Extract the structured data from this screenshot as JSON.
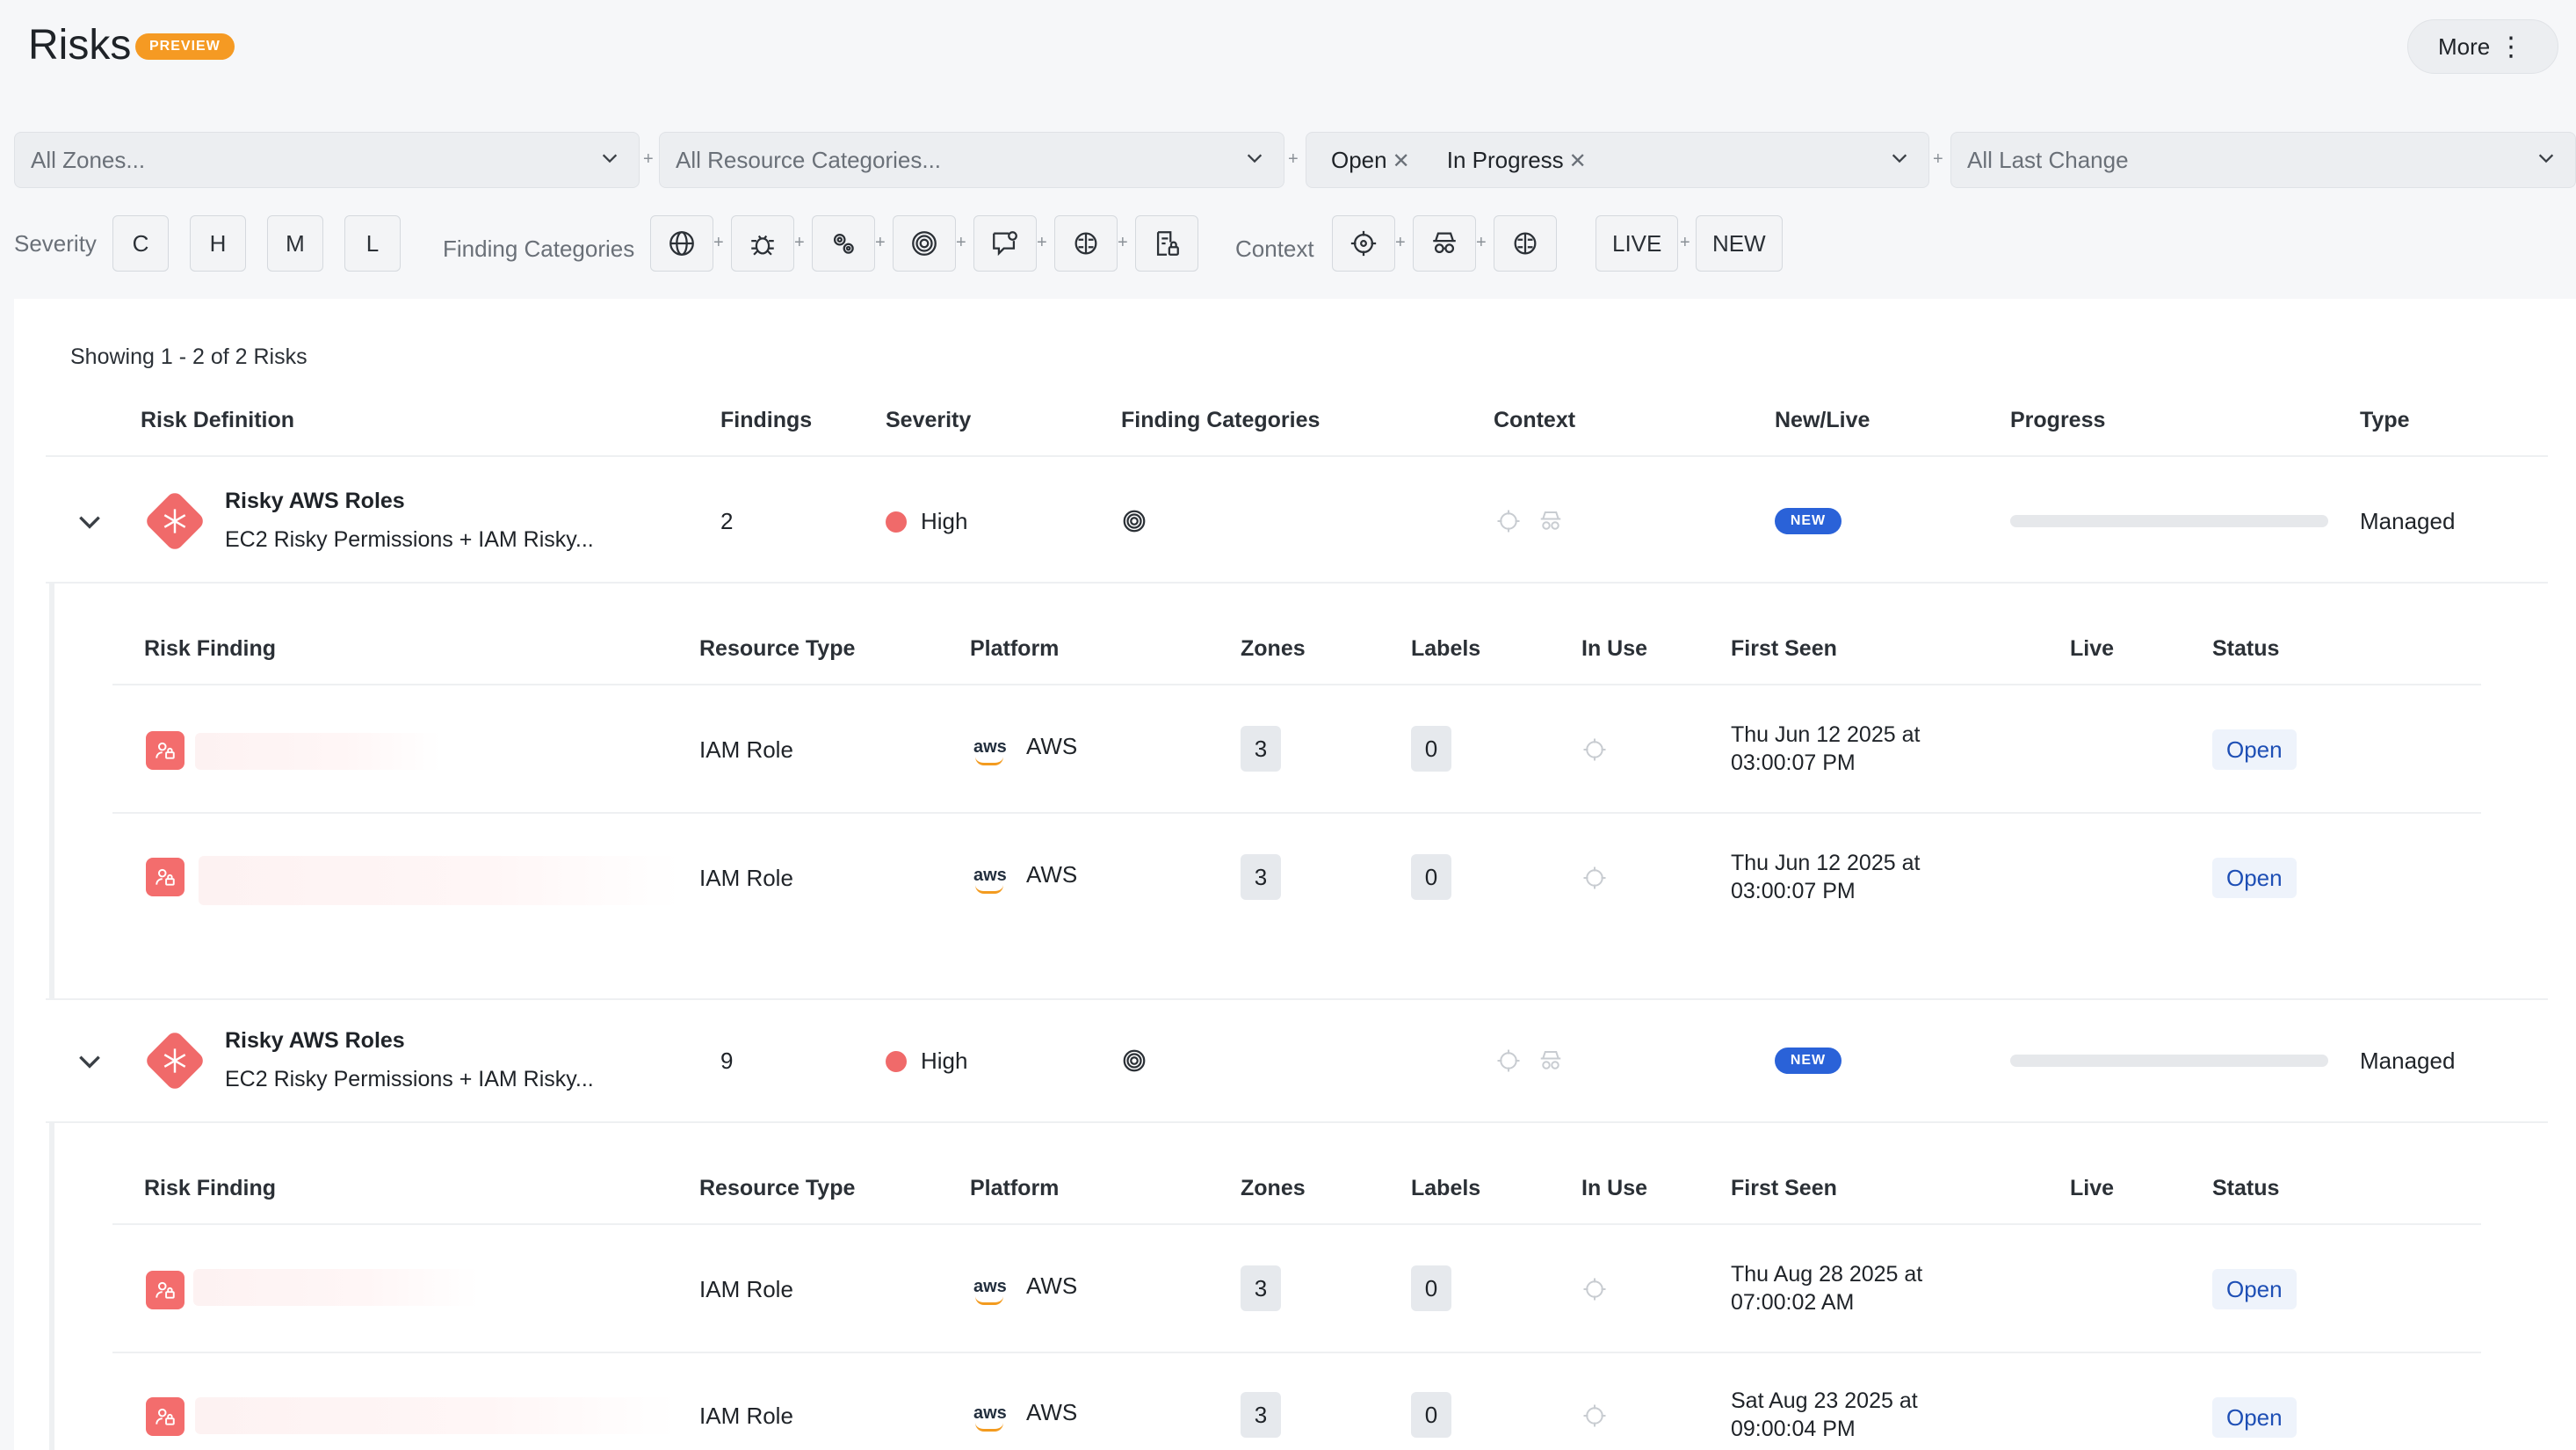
{
  "header": {
    "title": "Risks",
    "badge": "PREVIEW",
    "more_label": "More",
    "more_icon": "kebab-icon"
  },
  "filters": {
    "zones": "All Zones...",
    "resource_categories": "All Resource Categories...",
    "status_chips": [
      "Open",
      "In Progress"
    ],
    "last_change": "All Last Change",
    "plus": "+"
  },
  "toggles": {
    "severity_label": "Severity",
    "severity": [
      "C",
      "H",
      "M",
      "L"
    ],
    "finding_categories_label": "Finding Categories",
    "finding_category_icons": [
      "globe-icon",
      "bug-icon",
      "gears-icon",
      "fingerprint-icon",
      "chat-badge-icon",
      "brain-icon",
      "lock-document-icon"
    ],
    "context_label": "Context",
    "context_icons": [
      "crosshair-icon",
      "spy-icon",
      "brain-icon"
    ],
    "live": "LIVE",
    "new": "NEW"
  },
  "summary": "Showing 1 - 2 of 2 Risks",
  "table": {
    "columns": [
      "Risk Definition",
      "Findings",
      "Severity",
      "Finding Categories",
      "Context",
      "New/Live",
      "Progress",
      "Type"
    ],
    "sub_columns": [
      "Risk Finding",
      "Resource Type",
      "Platform",
      "Zones",
      "Labels",
      "In Use",
      "First Seen",
      "Live",
      "Status"
    ],
    "risks": [
      {
        "title": "Risky AWS Roles",
        "subtitle": "EC2 Risky Permissions + IAM Risky...",
        "findings": "2",
        "severity": "High",
        "badge": "NEW",
        "progress": 0,
        "type": "Managed",
        "rows": [
          {
            "resource_type": "IAM Role",
            "platform": "AWS",
            "zones": "3",
            "labels": "0",
            "first_seen_1": "Thu Jun 12 2025 at",
            "first_seen_2": "03:00:07 PM",
            "status": "Open"
          },
          {
            "resource_type": "IAM Role",
            "platform": "AWS",
            "zones": "3",
            "labels": "0",
            "first_seen_1": "Thu Jun 12 2025 at",
            "first_seen_2": "03:00:07 PM",
            "status": "Open"
          }
        ]
      },
      {
        "title": "Risky AWS Roles",
        "subtitle": "EC2 Risky Permissions + IAM Risky...",
        "findings": "9",
        "severity": "High",
        "badge": "NEW",
        "progress": 0,
        "type": "Managed",
        "rows": [
          {
            "resource_type": "IAM Role",
            "platform": "AWS",
            "zones": "3",
            "labels": "0",
            "first_seen_1": "Thu Aug 28 2025 at",
            "first_seen_2": "07:00:02 AM",
            "status": "Open"
          },
          {
            "resource_type": "IAM Role",
            "platform": "AWS",
            "zones": "3",
            "labels": "0",
            "first_seen_1": "Sat Aug 23 2025 at",
            "first_seen_2": "09:00:04 PM",
            "status": "Open"
          }
        ]
      }
    ]
  },
  "colors": {
    "accent": "#2a62d8",
    "danger": "#f06a6a",
    "preview": "#f59a23"
  }
}
